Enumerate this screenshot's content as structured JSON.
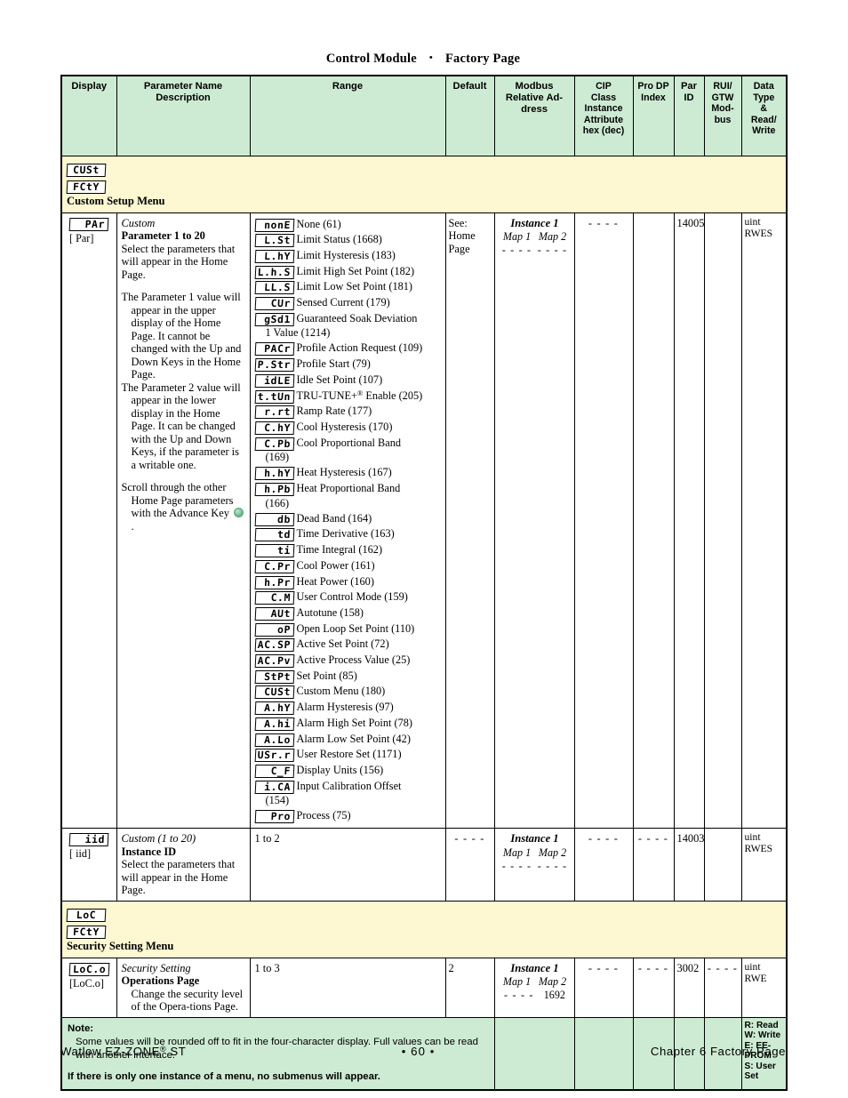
{
  "running_head": {
    "left": "Control Module",
    "bullet": "•",
    "right": "Factory Page"
  },
  "table": {
    "headers": {
      "display": "Display",
      "param_name": "Parameter Name\nDescription",
      "param_name_l1": "Parameter Name",
      "param_name_l2": "Description",
      "range": "Range",
      "default": "Default",
      "modbus_l1": "Modbus",
      "modbus_l2": "Relative Ad-",
      "modbus_l3": "dress",
      "cip_l1": "CIP",
      "cip_l2": "Class",
      "cip_l3": "Instance",
      "cip_l4": "Attribute",
      "cip_l5": "hex (dec)",
      "prodp_l1": "Pro DP",
      "prodp_l2": "Index",
      "parid_l1": "Par",
      "parid_l2": "ID",
      "rui_l1": "RUI/",
      "rui_l2": "GTW",
      "rui_l3": "Mod-",
      "rui_l4": "bus",
      "dtype_l1": "Data",
      "dtype_l2": "Type",
      "dtype_l3": "&",
      "dtype_l4": "Read/",
      "dtype_l5": "Write"
    },
    "menu_custom": {
      "seg1": "CUSt",
      "seg2": "FCtY",
      "title": "Custom Setup Menu"
    },
    "menu_security": {
      "seg1": "LoC",
      "seg2": "FCtY",
      "title": "Security Setting Menu"
    },
    "rows": [
      {
        "display_seg": "PAr",
        "display_bracket": "[ Par]",
        "desc_ital": "Custom",
        "desc_title": "Parameter 1 to 20",
        "desc_p1": "Select the parameters that will appear in the Home Page.",
        "desc_p2": "The Parameter 1 value will appear in the upper display of the Home Page. It cannot be changed with the Up and Down Keys in the Home Page.",
        "desc_p3": "The Parameter 2 value will appear in the lower display in the Home Page. It can be changed with the Up and Down Keys, if the parameter is a writable one.",
        "desc_p4a": "Scroll through the",
        "desc_p4b": "other Home Page parameters with the Advance Key",
        "desc_p4c": ".",
        "default_l1": "See:",
        "default_l2": "Home",
        "default_l3": "Page",
        "modbus_instance": "Instance 1",
        "modbus_map1": "Map 1",
        "modbus_map2": "Map 2",
        "modbus_v1": "- - - -",
        "modbus_v2": "- - - -",
        "cip": "- - - -",
        "prodp": "",
        "parid": "14005",
        "rui": "",
        "dtype_l1": "uint",
        "dtype_l2": "RWES"
      },
      {
        "display_seg": "iid",
        "display_bracket": "[ iid]",
        "desc_ital": "Custom (1 to 20)",
        "desc_title": "Instance ID",
        "desc_p1": "Select the parameters that will appear in the Home Page.",
        "range": "1 to 2",
        "default": "- - - -",
        "modbus_instance": "Instance 1",
        "modbus_map1": "Map 1",
        "modbus_map2": "Map 2",
        "modbus_v1": "- - - -",
        "modbus_v2": "- - - -",
        "cip": "- - - -",
        "prodp": "- - - -",
        "parid": "14003",
        "rui": "",
        "dtype_l1": "uint",
        "dtype_l2": "RWES"
      },
      {
        "display_seg": "LoC.o",
        "display_bracket": "[LoC.o]",
        "desc_ital": "Security Setting",
        "desc_title": "Operations Page",
        "desc_p1": "Change the security level of the Opera-tions Page.",
        "range": "1 to 3",
        "default": "2",
        "modbus_instance": "Instance 1",
        "modbus_map1": "Map 1",
        "modbus_map2": "Map 2",
        "modbus_v1": "- - - -",
        "modbus_v2": "1692",
        "cip": "- - - -",
        "prodp": "- - - -",
        "parid": "3002",
        "rui": "- - - -",
        "dtype_l1": "uint",
        "dtype_l2": "RWE"
      }
    ],
    "range_list": [
      {
        "seg": "nonE",
        "label": "None (61)"
      },
      {
        "seg": "L.St",
        "label": "Limit Status (1668)"
      },
      {
        "seg": "L.hY",
        "label": "Limit Hysteresis (183)"
      },
      {
        "seg": "L.h.S",
        "label": "Limit High Set Point (182)"
      },
      {
        "seg": "LL.S",
        "label": "Limit Low Set Point (181)"
      },
      {
        "seg": "CUr",
        "label": "Sensed Current (179)"
      },
      {
        "seg": "gSd1",
        "label": "Guaranteed Soak Deviation",
        "cont": "1 Value (1214)"
      },
      {
        "seg": "PACr",
        "label": "Profile Action Request (109)"
      },
      {
        "seg": "P.Str",
        "label": "Profile Start (79)"
      },
      {
        "seg": "idLE",
        "label": "Idle Set Point (107)"
      },
      {
        "seg": "t.tUn",
        "label": "TRU-TUNE+",
        "sup": "®",
        "label2": " Enable (205)"
      },
      {
        "seg": "r.rt",
        "label": "Ramp Rate (177)"
      },
      {
        "seg": "C.hY",
        "label": "Cool Hysteresis (170)"
      },
      {
        "seg": "C.Pb",
        "label": "Cool Proportional Band",
        "cont": "(169)"
      },
      {
        "seg": "h.hY",
        "label": "Heat Hysteresis (167)"
      },
      {
        "seg": "h.Pb",
        "label": "Heat Proportional Band",
        "cont": "(166)"
      },
      {
        "seg": "db",
        "label": "Dead Band (164)"
      },
      {
        "seg": "td",
        "label": "Time Derivative (163)"
      },
      {
        "seg": "ti",
        "label": "Time Integral (162)"
      },
      {
        "seg": "C.Pr",
        "label": "Cool Power (161)"
      },
      {
        "seg": "h.Pr",
        "label": "Heat Power (160)"
      },
      {
        "seg": "C.M",
        "label": "User Control Mode (159)"
      },
      {
        "seg": "AUt",
        "label": "Autotune (158)"
      },
      {
        "seg": "oP",
        "label": "Open Loop Set Point (110)"
      },
      {
        "seg": "AC.SP",
        "label": "Active Set Point (72)"
      },
      {
        "seg": "AC.Pv",
        "label": "Active Process Value (25)"
      },
      {
        "seg": "StPt",
        "label": "Set Point (85)"
      },
      {
        "seg": "CUSt",
        "label": "Custom Menu (180)"
      },
      {
        "seg": "A.hY",
        "label": "Alarm Hysteresis (97)"
      },
      {
        "seg": "A.hi",
        "label": "Alarm High Set Point (78)"
      },
      {
        "seg": "A.Lo",
        "label": "Alarm Low Set Point (42)"
      },
      {
        "seg": "USr.r",
        "label": "User Restore Set (1171)"
      },
      {
        "seg": "C_F",
        "label": "Display Units (156)"
      },
      {
        "seg": "i.CA",
        "label": "Input Calibration Offset",
        "cont": "(154)"
      },
      {
        "seg": "Pro",
        "label": "Process (75)"
      }
    ],
    "note": {
      "title": "Note:",
      "body": "Some values will be rounded off to fit in the four-character display. Full values can be read with another interface.",
      "bold": "If there is only one instance of a menu, no submenus will appear."
    },
    "legend": {
      "l1": "R: Read",
      "l2": "W: Write",
      "l3": "E: EE-",
      "l4": "PROM",
      "l5": "S: User",
      "l6": "Set"
    }
  },
  "footer": {
    "left": "Watlow EZ-ZONE",
    "left_sup": "®",
    "left_end": " ST",
    "mid": "•  60  •",
    "right": "Chapter 6 Factory Page"
  },
  "colors": {
    "header_green": "#cdebd3",
    "menu_yellow": "#fdf8d2",
    "advance_key_green": "#74c194"
  }
}
